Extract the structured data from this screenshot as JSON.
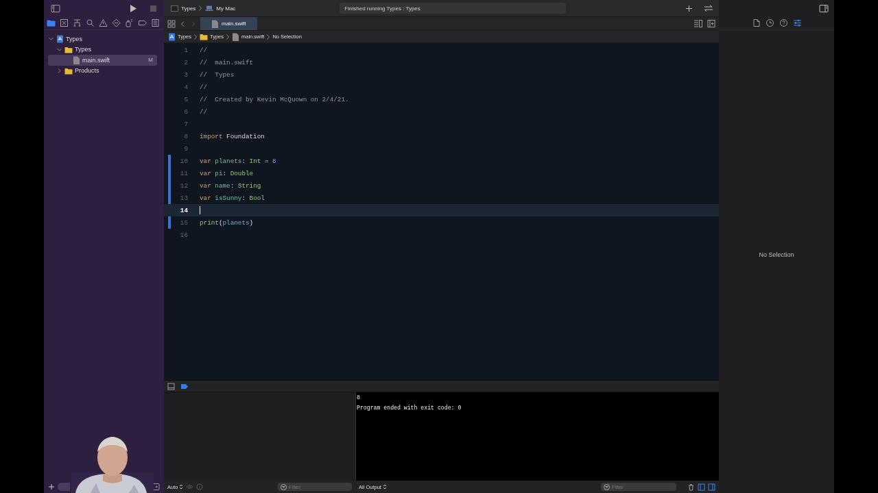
{
  "toolbar": {
    "scheme": "Types",
    "destination": "My Mac",
    "status": "Finished running Types : Types"
  },
  "navigator": {
    "tabs": [
      {
        "kind": "folder",
        "selected": true
      },
      {
        "kind": "xbox",
        "selected": false
      },
      {
        "kind": "hierarchy",
        "selected": false
      },
      {
        "kind": "search",
        "selected": false
      },
      {
        "kind": "warning",
        "selected": false
      },
      {
        "kind": "diamond",
        "selected": false
      },
      {
        "kind": "spray",
        "selected": false
      },
      {
        "kind": "tag",
        "selected": false
      },
      {
        "kind": "list",
        "selected": false
      }
    ],
    "tree": [
      {
        "label": "Types",
        "kind": "project",
        "expanded": true,
        "selected": false,
        "children": [
          {
            "label": "Types",
            "kind": "folder",
            "expanded": true,
            "selected": false,
            "children": [
              {
                "label": "main.swift",
                "kind": "file",
                "selected": true,
                "badge": "M"
              }
            ]
          },
          {
            "label": "Products",
            "kind": "folder",
            "expanded": false,
            "selected": false
          }
        ]
      }
    ]
  },
  "editor": {
    "tabs": [
      {
        "label": "main.swift",
        "selected": true
      }
    ],
    "breadcrumb": [
      {
        "label": "Types",
        "kind": "project"
      },
      {
        "label": "Types",
        "kind": "folder"
      },
      {
        "label": "main.swift",
        "kind": "file"
      },
      {
        "label": "No Selection",
        "kind": "text"
      }
    ],
    "lines": [
      {
        "number": "1",
        "changed": false,
        "current": false,
        "tokens": [
          {
            "kind": "comment",
            "text": "//"
          }
        ]
      },
      {
        "number": "2",
        "changed": false,
        "current": false,
        "tokens": [
          {
            "kind": "comment",
            "text": "//  main.swift"
          }
        ]
      },
      {
        "number": "3",
        "changed": false,
        "current": false,
        "tokens": [
          {
            "kind": "comment",
            "text": "//  Types"
          }
        ]
      },
      {
        "number": "4",
        "changed": false,
        "current": false,
        "tokens": [
          {
            "kind": "comment",
            "text": "//"
          }
        ]
      },
      {
        "number": "5",
        "changed": false,
        "current": false,
        "tokens": [
          {
            "kind": "comment",
            "text": "//  Created by Kevin McQuown on 2/4/21."
          }
        ]
      },
      {
        "number": "6",
        "changed": false,
        "current": false,
        "tokens": [
          {
            "kind": "comment",
            "text": "//"
          }
        ]
      },
      {
        "number": "7",
        "changed": false,
        "current": false
      },
      {
        "number": "8",
        "changed": false,
        "current": false,
        "tokens": [
          {
            "kind": "keyword",
            "text": "import"
          },
          {
            "kind": "plain",
            "text": " Foundation"
          }
        ]
      },
      {
        "number": "9",
        "changed": false,
        "current": false
      },
      {
        "number": "10",
        "changed": true,
        "current": false,
        "tokens": [
          {
            "kind": "keyword",
            "text": "var"
          },
          {
            "kind": "decl",
            "text": " planets"
          },
          {
            "kind": "plain",
            "text": ": "
          },
          {
            "kind": "type",
            "text": "Int"
          },
          {
            "kind": "plain",
            "text": " = "
          },
          {
            "kind": "number",
            "text": "8"
          }
        ]
      },
      {
        "number": "11",
        "changed": true,
        "current": false,
        "tokens": [
          {
            "kind": "keyword",
            "text": "var"
          },
          {
            "kind": "decl",
            "text": " pi"
          },
          {
            "kind": "plain",
            "text": ": "
          },
          {
            "kind": "type",
            "text": "Double"
          }
        ]
      },
      {
        "number": "12",
        "changed": true,
        "current": false,
        "tokens": [
          {
            "kind": "keyword",
            "text": "var"
          },
          {
            "kind": "decl",
            "text": " name"
          },
          {
            "kind": "plain",
            "text": ": "
          },
          {
            "kind": "type",
            "text": "String"
          }
        ]
      },
      {
        "number": "13",
        "changed": true,
        "current": false,
        "tokens": [
          {
            "kind": "keyword",
            "text": "var"
          },
          {
            "kind": "decl",
            "text": " isSunny"
          },
          {
            "kind": "plain",
            "text": ": "
          },
          {
            "kind": "type",
            "text": "Bool"
          }
        ]
      },
      {
        "number": "14",
        "changed": false,
        "current": true
      },
      {
        "number": "15",
        "changed": true,
        "current": false,
        "tokens": [
          {
            "kind": "func",
            "text": "print"
          },
          {
            "kind": "plain",
            "text": "("
          },
          {
            "kind": "ref",
            "text": "planets"
          },
          {
            "kind": "plain",
            "text": ")"
          }
        ]
      },
      {
        "number": "16",
        "changed": false,
        "current": false
      }
    ]
  },
  "variables": {
    "scope": "Auto",
    "filter_placeholder": "Filter"
  },
  "console": {
    "output": [
      "8",
      "Program ended with exit code: 0"
    ],
    "scope": "All Output",
    "filter_placeholder": "Filter"
  },
  "inspector": {
    "message": "No Selection",
    "tabs": [
      {
        "kind": "file",
        "selected": false
      },
      {
        "kind": "clock",
        "selected": false
      },
      {
        "kind": "help",
        "selected": false
      },
      {
        "kind": "attributes",
        "selected": true
      }
    ]
  }
}
